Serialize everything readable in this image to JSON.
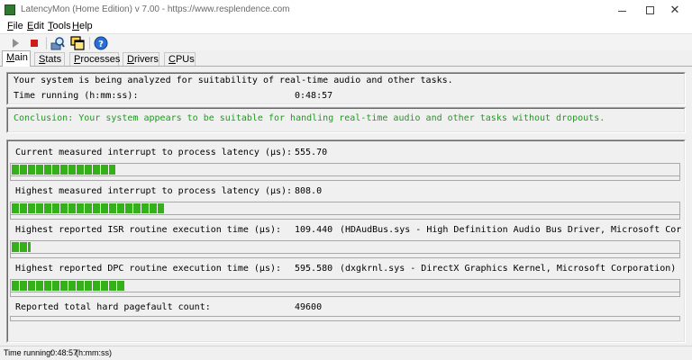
{
  "window": {
    "title": "LatencyMon  (Home Edition)  v 7.00 - https://www.resplendence.com",
    "minimize_glyph": "",
    "maximize_glyph": "",
    "close_glyph": "✕"
  },
  "menu": {
    "file": {
      "ul": "F",
      "rest": "ile"
    },
    "edit": {
      "ul": "E",
      "rest": "dit"
    },
    "tools": {
      "ul": "T",
      "rest": "ools"
    },
    "help": {
      "ul": "H",
      "rest": "elp"
    }
  },
  "toolbar": {
    "icons": [
      "play-icon",
      "stop-icon",
      "analyze-icon",
      "windows-icon",
      "help-icon"
    ]
  },
  "tabs": [
    {
      "ul": "M",
      "rest": "ain"
    },
    {
      "ul": "S",
      "rest": "tats"
    },
    {
      "ul": "P",
      "rest": "rocesses"
    },
    {
      "ul": "D",
      "rest": "rivers"
    },
    {
      "ul": "C",
      "rest": "PUs"
    }
  ],
  "main": {
    "analysis_text": "Your system is being analyzed for suitability of real-time audio and other tasks.",
    "time_running_label": "Time running (h:mm:ss):",
    "time_running_value": "0:48:57",
    "conclusion": "Conclusion: Your system appears to be suitable for handling real-time audio and other tasks without dropouts.",
    "metrics": [
      {
        "label": "Current measured interrupt to process latency (µs):",
        "value": "555.70",
        "detail": "",
        "level": 0.156
      },
      {
        "label": "Highest measured interrupt to process latency (µs):",
        "value": "808.0",
        "detail": "",
        "level": 0.228
      },
      {
        "label": "Highest reported ISR routine execution time (µs):",
        "value": "109.440",
        "detail": "(HDAudBus.sys - High Definition Audio Bus Driver, Microsoft Corporation)",
        "level": 0.029
      },
      {
        "label": "Highest reported DPC routine execution time (µs):",
        "value": "595.580",
        "detail": "(dxgkrnl.sys - DirectX Graphics Kernel, Microsoft Corporation)",
        "level": 0.169
      }
    ],
    "pagefault_label": "Reported total hard pagefault count:",
    "pagefault_value": "49600"
  },
  "statusbar": {
    "label": "Time running:",
    "value": "0:48:57",
    "unit": "(h:mm:ss)"
  },
  "colors": {
    "bar_green": "#33b01a",
    "conclusion_green": "#1e9b1e",
    "stop_red": "#d11a1a"
  }
}
